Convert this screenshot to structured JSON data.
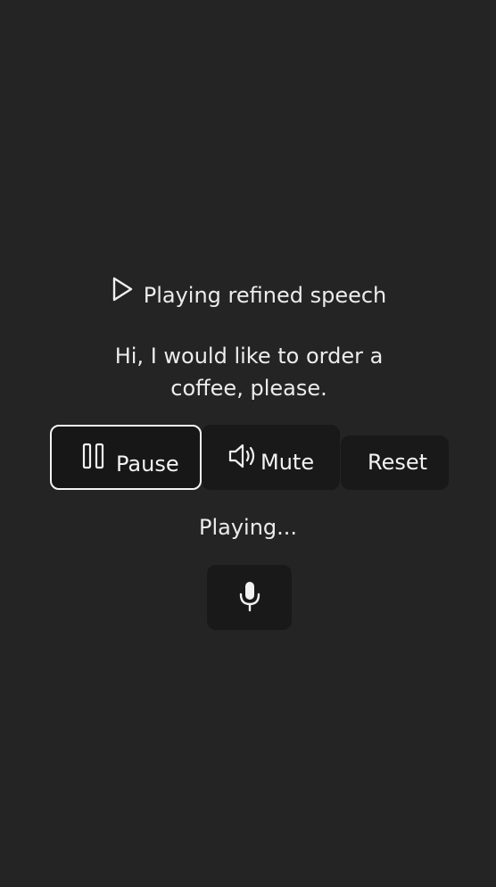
{
  "header": {
    "icon": "play-icon",
    "title": "Playing refined speech"
  },
  "transcript": "Hi, I would like to order a coffee, please.",
  "controls": {
    "pause": {
      "label": "Pause",
      "icon": "pause-icon",
      "focused": true
    },
    "mute": {
      "label": "Mute",
      "icon": "speaker-icon"
    },
    "reset": {
      "label": "Reset"
    }
  },
  "status": "Playing...",
  "mic": {
    "icon": "microphone-icon"
  },
  "colors": {
    "background": "#242424",
    "button": "#191919",
    "text": "#ececec",
    "focus_border": "#f4f4f4"
  }
}
